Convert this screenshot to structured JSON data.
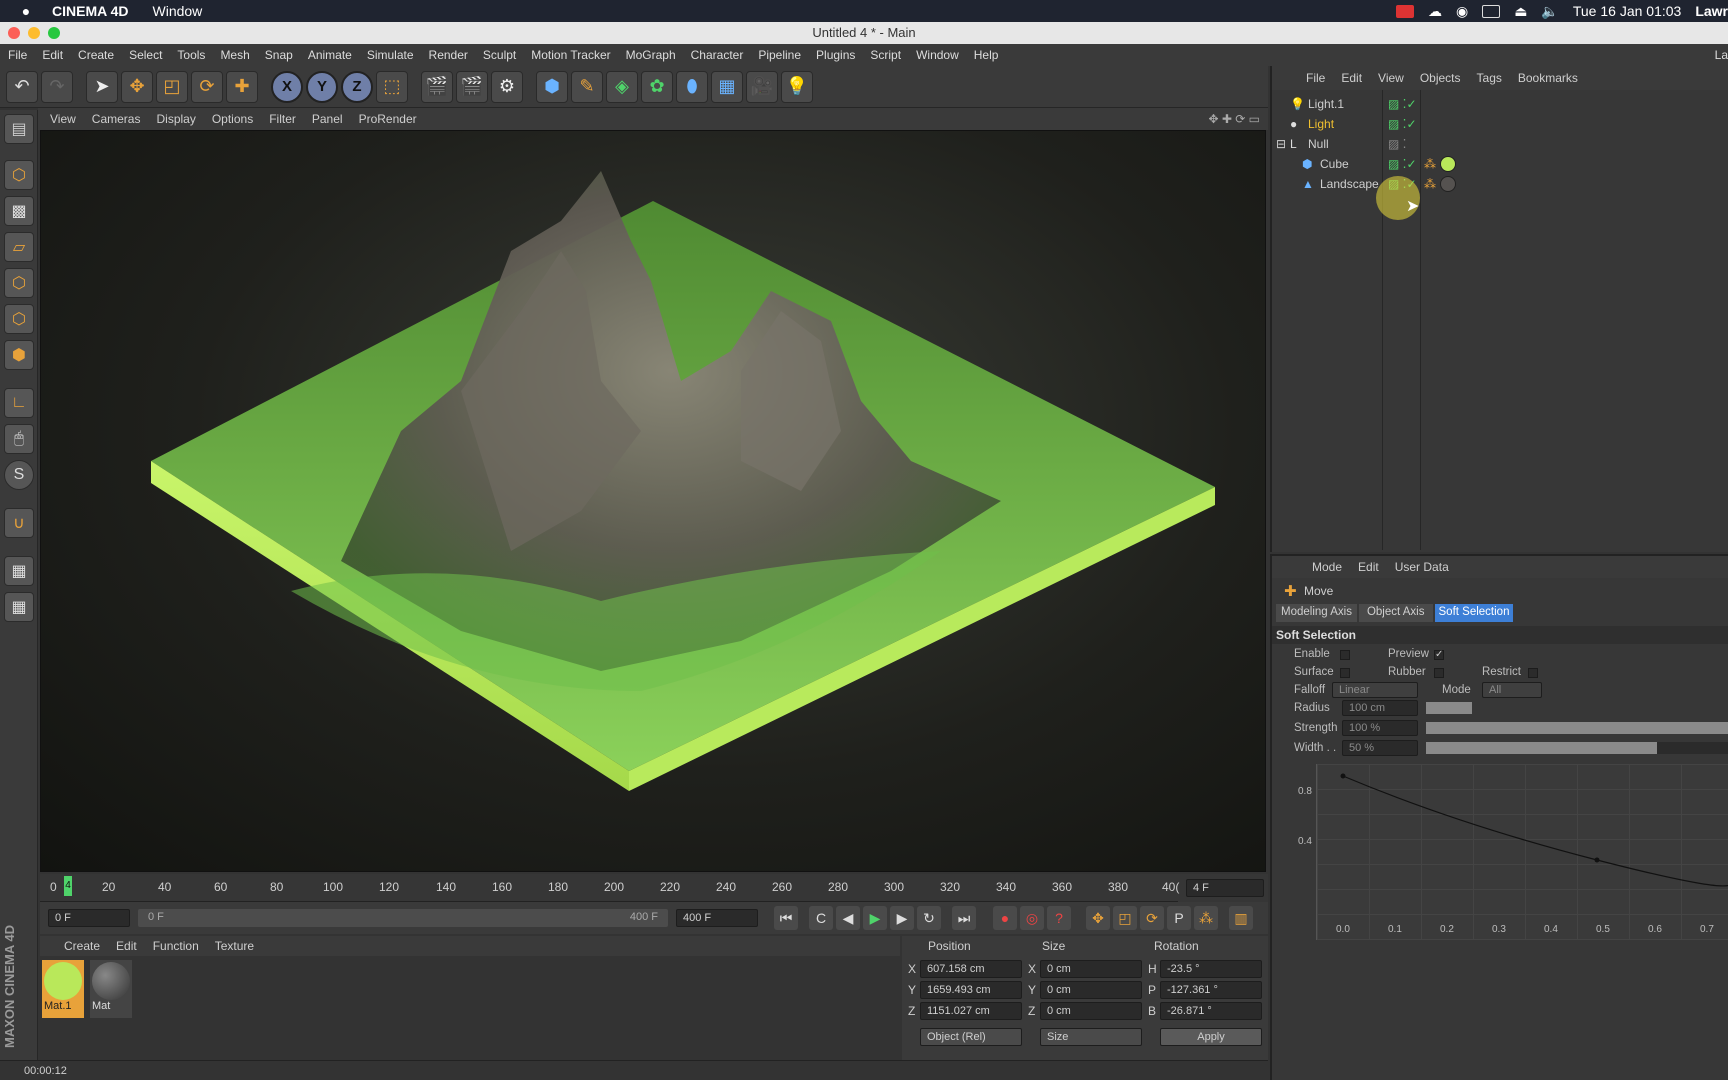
{
  "mac_menubar": {
    "app_name": "CINEMA 4D",
    "window_menu": "Window",
    "datetime": "Tue 16 Jan  01:03",
    "user_truncated": "Lawr"
  },
  "window": {
    "title": "Untitled 4 * - Main"
  },
  "main_menu": [
    "File",
    "Edit",
    "Create",
    "Select",
    "Tools",
    "Mesh",
    "Snap",
    "Animate",
    "Simulate",
    "Render",
    "Sculpt",
    "Motion Tracker",
    "MoGraph",
    "Character",
    "Pipeline",
    "Plugins",
    "Script",
    "Window",
    "Help"
  ],
  "menu_right_truncated": "La",
  "toolbar": {
    "icons": [
      "undo-icon",
      "redo-icon",
      "select-arrow-icon",
      "move-icon",
      "scale-icon",
      "rotate-icon",
      "add-icon"
    ],
    "axis_labels": [
      "X",
      "Y",
      "Z"
    ]
  },
  "viewport_menu": [
    "View",
    "Cameras",
    "Display",
    "Options",
    "Filter",
    "Panel",
    "ProRender"
  ],
  "object_manager": {
    "menu": [
      "File",
      "Edit",
      "View",
      "Objects",
      "Tags",
      "Bookmarks"
    ],
    "objects": [
      {
        "name": "Light.1",
        "highlight": false
      },
      {
        "name": "Light",
        "highlight": true
      },
      {
        "name": "Null",
        "highlight": false
      },
      {
        "name": "Cube",
        "highlight": false
      },
      {
        "name": "Landscape",
        "highlight": false
      }
    ]
  },
  "attributes": {
    "menu": [
      "Mode",
      "Edit",
      "User Data"
    ],
    "tool_name": "Move",
    "tabs": [
      "Modeling Axis",
      "Object Axis",
      "Soft Selection"
    ],
    "active_tab": "Soft Selection",
    "section_title": "Soft Selection",
    "enable_label": "Enable",
    "preview_label": "Preview",
    "surface_label": "Surface",
    "rubber_label": "Rubber",
    "restrict_label": "Restrict",
    "falloff_label": "Falloff",
    "falloff_value": "Linear",
    "mode_label": "Mode",
    "mode_value": "All",
    "radius_label": "Radius",
    "radius_value": "100 cm",
    "strength_label": "Strength",
    "strength_value": "100 %",
    "width_label": "Width . .",
    "width_value": "50 %",
    "graph_y_ticks": [
      "0.8",
      "0.4"
    ],
    "graph_x_ticks": [
      "0.0",
      "0.1",
      "0.2",
      "0.3",
      "0.4",
      "0.5",
      "0.6",
      "0.7"
    ]
  },
  "timeline": {
    "ticks": [
      "0",
      "4",
      "20",
      "40",
      "60",
      "80",
      "100",
      "120",
      "140",
      "160",
      "180",
      "200",
      "220",
      "240",
      "260",
      "280",
      "300",
      "320",
      "340",
      "360",
      "380",
      "40("
    ],
    "current_frame_field": "4 F",
    "start_field": "0 F",
    "range_start": "0 F",
    "range_end": "400 F",
    "end_field": "400 F"
  },
  "material_manager": {
    "menu": [
      "Create",
      "Edit",
      "Function",
      "Texture"
    ],
    "materials": [
      {
        "name": "Mat.1",
        "selected": true,
        "color": "#b9e85a"
      },
      {
        "name": "Mat",
        "selected": false,
        "color": "#555250"
      }
    ]
  },
  "coordinates": {
    "headers": [
      "Position",
      "Size",
      "Rotation"
    ],
    "rows": [
      {
        "axis": "X",
        "pos": "607.158 cm",
        "size_axis": "X",
        "size": "0 cm",
        "rot_axis": "H",
        "rot": "-23.5 °"
      },
      {
        "axis": "Y",
        "pos": "1659.493 cm",
        "size_axis": "Y",
        "size": "0 cm",
        "rot_axis": "P",
        "rot": "-127.361 °"
      },
      {
        "axis": "Z",
        "pos": "1151.027 cm",
        "size_axis": "Z",
        "size": "0 cm",
        "rot_axis": "B",
        "rot": "-26.871 °"
      }
    ],
    "mode_select": "Object (Rel)",
    "size_select": "Size",
    "apply": "Apply"
  },
  "status": {
    "time": "00:00:12"
  },
  "branding": "MAXON CINEMA 4D",
  "colors": {
    "accent_orange": "#e8a23a",
    "highlight_yellow": "#f0c030",
    "active_tab_blue": "#3d7fd6",
    "mat_green": "#b9e85a"
  }
}
